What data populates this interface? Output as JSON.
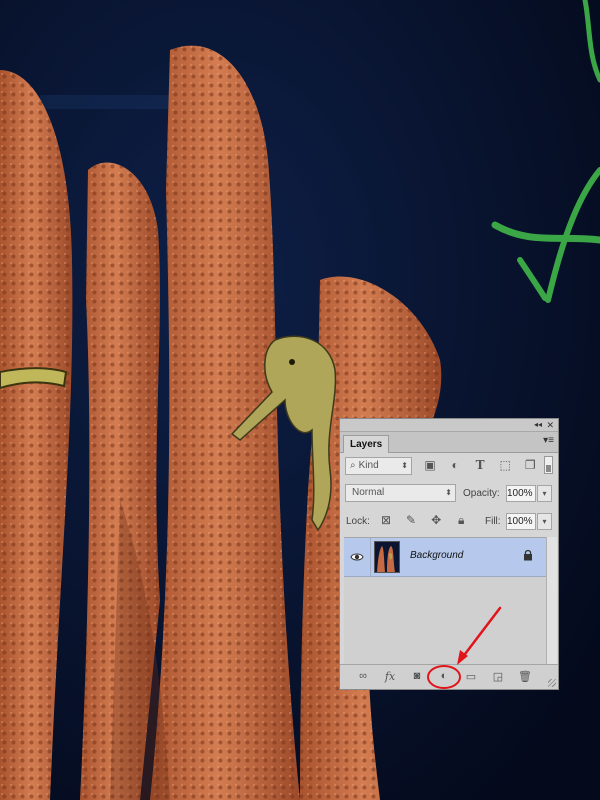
{
  "panel": {
    "tab_label": "Layers",
    "collapse_glyph": "◂◂",
    "close_glyph": "✕",
    "menu_glyph": "▾≡"
  },
  "filter": {
    "kind_label": "Kind",
    "icons": [
      "image-filter-icon",
      "adjustment-filter-icon",
      "type-filter-icon",
      "shape-filter-icon",
      "smart-object-filter-icon"
    ]
  },
  "blend": {
    "mode": "Normal",
    "opacity_label": "Opacity:",
    "opacity_value": "100%"
  },
  "lock": {
    "label": "Lock:",
    "fill_label": "Fill:",
    "fill_value": "100%"
  },
  "layers": [
    {
      "name": "Background",
      "visible": true,
      "locked": true,
      "selected": true
    }
  ],
  "bottom_bar": {
    "icons": [
      "link-layers-icon",
      "fx-icon",
      "add-mask-icon",
      "new-adjustment-layer-icon",
      "new-group-icon",
      "new-layer-icon",
      "delete-layer-icon"
    ]
  },
  "colors": {
    "panel_bg": "#d6d6d6",
    "selected_row": "#b6c9ec",
    "annotation": "#e0141a",
    "coral": "#c56a42",
    "water": "#07112a"
  }
}
